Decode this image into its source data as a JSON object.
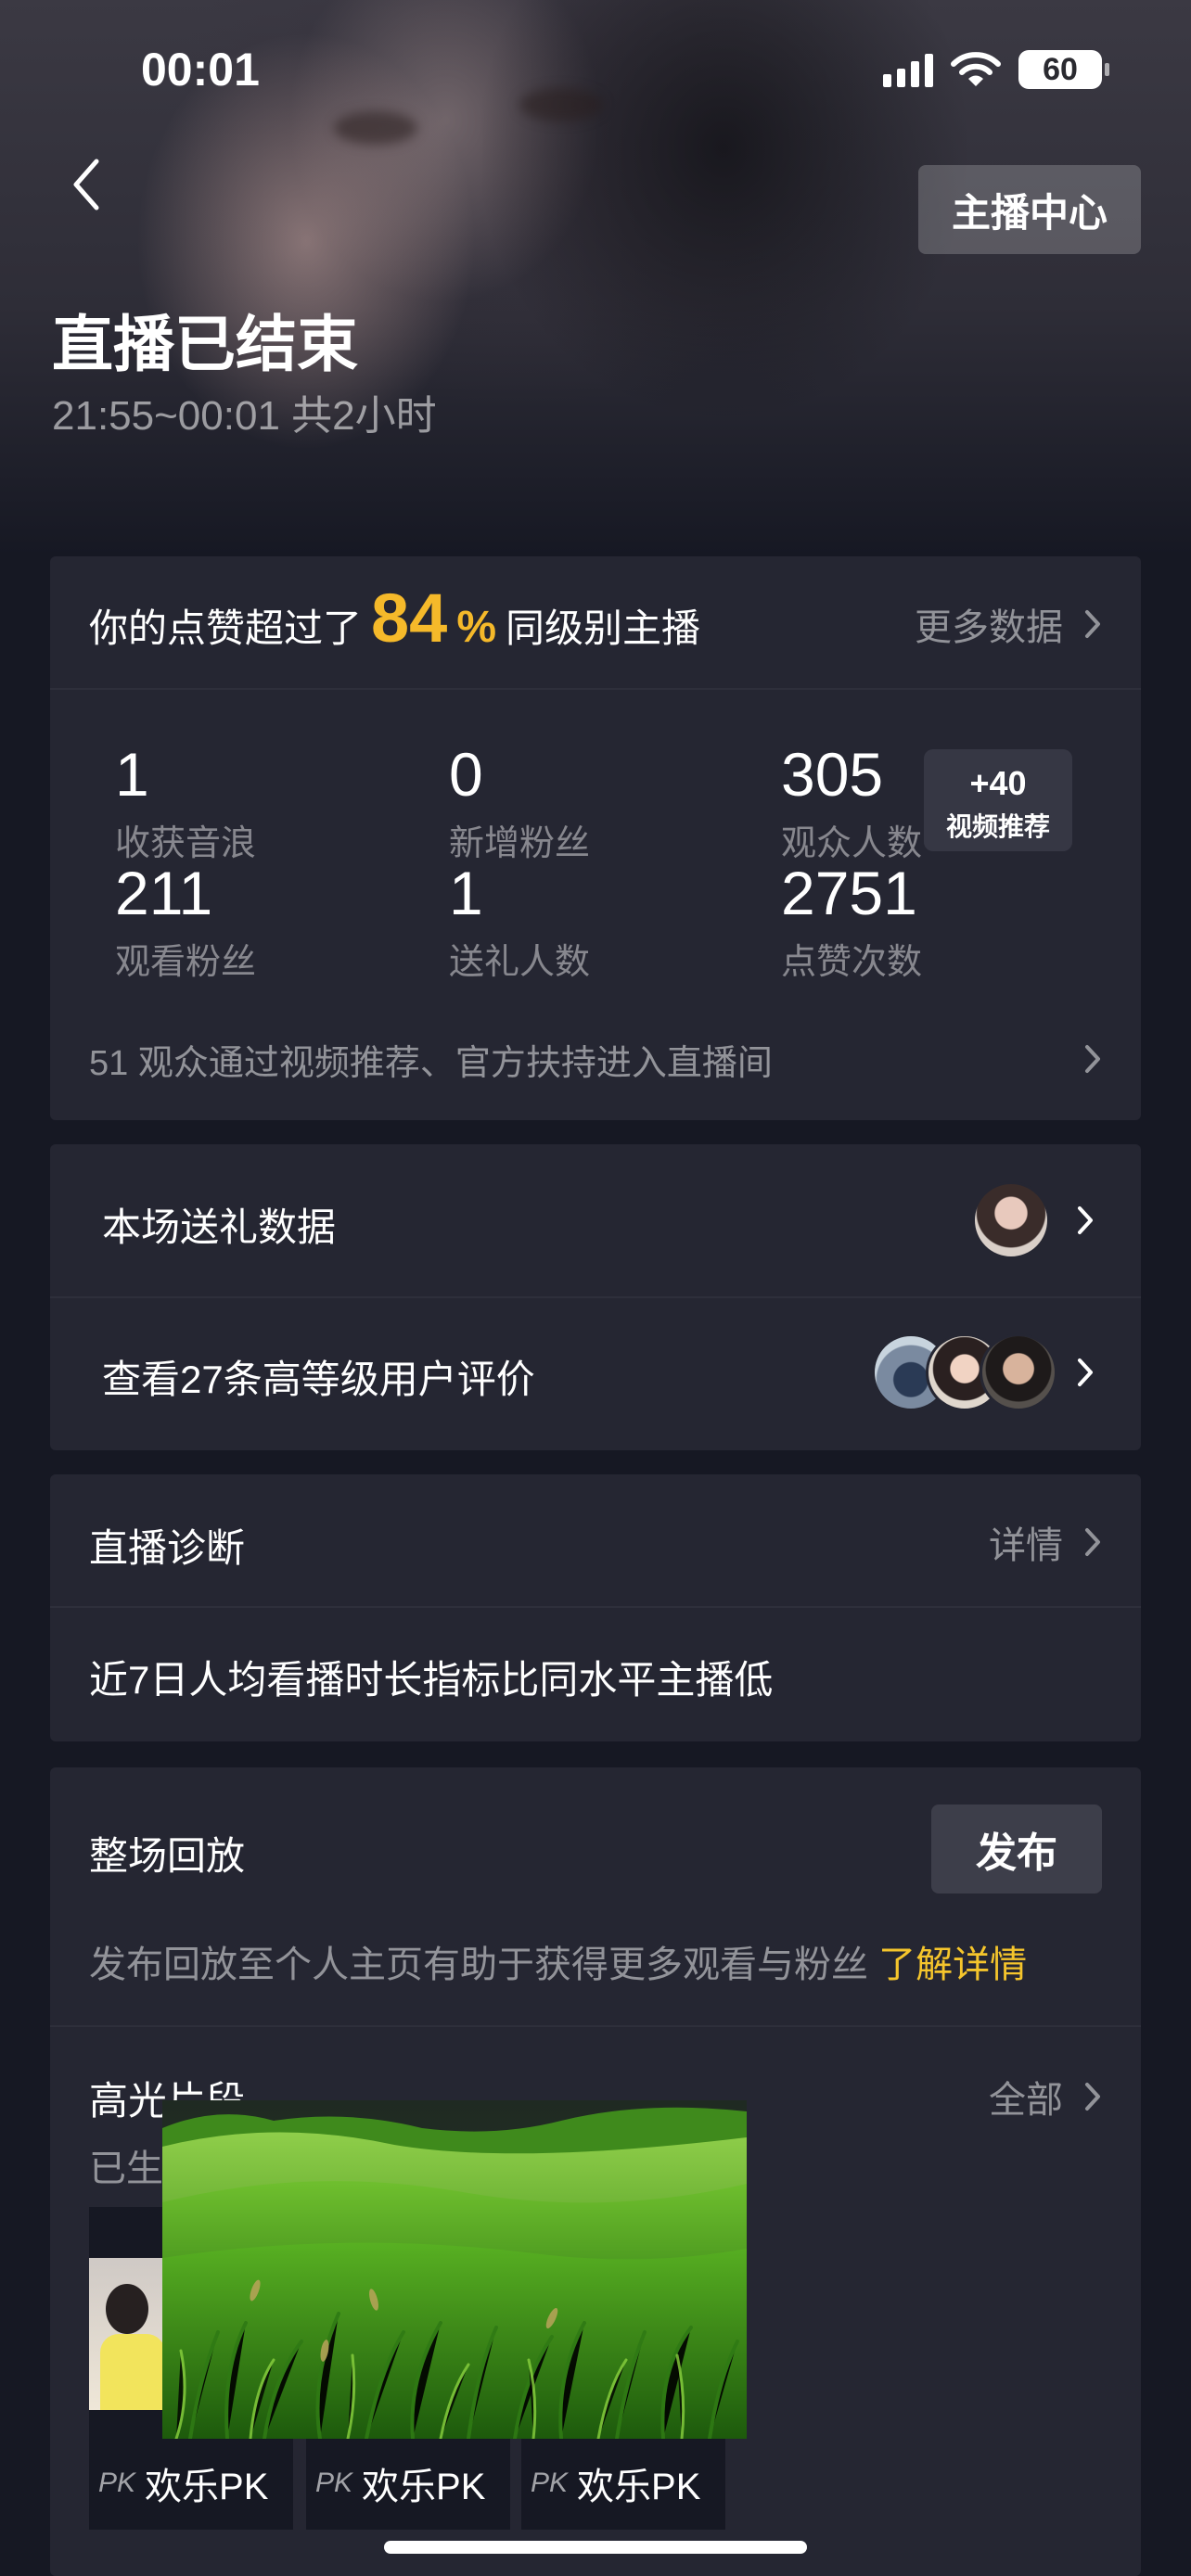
{
  "status_bar": {
    "time": "00:01",
    "battery": "60"
  },
  "header": {
    "anchor_center_label": "主播中心",
    "title": "直播已结束",
    "subtitle": "21:55~00:01 共2小时"
  },
  "summary": {
    "likes_prefix": "你的点赞超过了",
    "likes_percent": "84",
    "likes_percent_sign": "%",
    "likes_suffix": "同级别主播",
    "more_data": "更多数据",
    "stats": [
      {
        "value": "1",
        "label": "收获音浪"
      },
      {
        "value": "0",
        "label": "新增粉丝"
      },
      {
        "value": "305",
        "label": "观众人数"
      },
      {
        "value": "211",
        "label": "观看粉丝"
      },
      {
        "value": "1",
        "label": "送礼人数"
      },
      {
        "value": "2751",
        "label": "点赞次数"
      }
    ],
    "tooltip": {
      "value": "+40",
      "label": "视频推荐"
    },
    "recommend_note": "51 观众通过视频推荐、官方扶持进入直播间"
  },
  "gifts": {
    "gift_data_label": "本场送礼数据",
    "reviews_label": "查看27条高等级用户评价"
  },
  "diagnosis": {
    "title": "直播诊断",
    "details": "详情",
    "message": "近7日人均看播时长指标比同水平主播低"
  },
  "replay": {
    "title": "整场回放",
    "publish": "发布",
    "hint": "发布回放至个人主页有助于获得更多观看与粉丝",
    "learn_more": "了解详情",
    "highlights_title": "高光片段",
    "highlights_all": "全部",
    "highlights_sub": "已生",
    "clips": [
      {
        "pk": "PK",
        "label": "欢乐PK"
      },
      {
        "pk": "PK",
        "label": "欢乐PK"
      },
      {
        "pk": "PK",
        "label": "欢乐PK"
      }
    ]
  }
}
